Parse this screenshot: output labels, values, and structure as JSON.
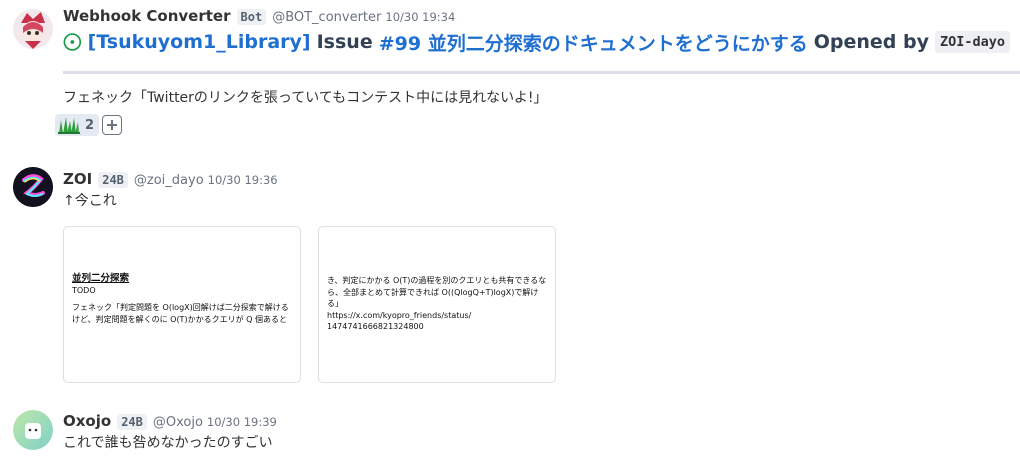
{
  "messages": [
    {
      "name": "Webhook Converter",
      "tag": "Bot",
      "handle": "@BOT_converter",
      "time": "10/30 19:34",
      "issue": {
        "repo": "[Tsukuyom1_Library]",
        "issue_word": "Issue",
        "title": "#99 並列二分探索のドキュメントをどうにかする",
        "opened_by": "Opened by",
        "user": "ZOI-dayo"
      },
      "text": "フェネック「Twitterのリンクを張っていてもコンテスト中には見れないよ!」",
      "stamp_count": "2"
    },
    {
      "name": "ZOI",
      "tag": "24B",
      "handle": "@zoi_dayo",
      "time": "10/30 19:36",
      "text": "↑今これ",
      "cards": [
        {
          "title": "並列二分探索",
          "sub": "TODO",
          "lines": [
            "フェネック「判定問題を O(logX)回解けば二分探索で解ける",
            "けど、判定問題を解くのに O(T)かかるクエリが Q 個あると"
          ]
        },
        {
          "lines": [
            "き、判定にかかる O(T)の過程を別のクエリとも共有できるな",
            "ら、全部まとめて計算できれば O((QlogQ+T)logX)で解ける」",
            "https://x.com/kyopro_friends/status/",
            "1474741666821324800"
          ]
        }
      ]
    },
    {
      "name": "Oxojo",
      "tag": "24B",
      "handle": "@Oxojo",
      "time": "10/30 19:39",
      "text": "これで誰も咎めなかったのすごい"
    }
  ],
  "colors": {
    "link": "#1f6fd1",
    "issue_open": "#1a9b46"
  }
}
